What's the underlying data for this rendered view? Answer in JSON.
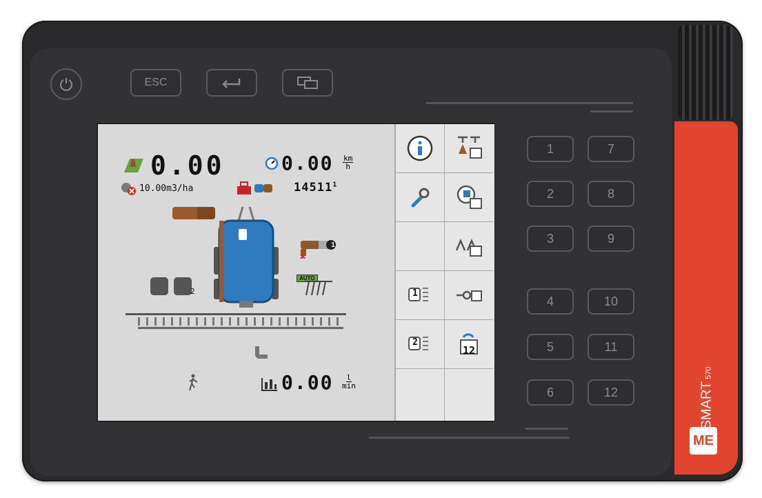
{
  "device": {
    "brand": "SMART",
    "model": "570",
    "logo_text": "ME",
    "keys": {
      "esc": "ESC",
      "power_icon": "power-icon",
      "enter_icon": "enter-icon",
      "switch_icon": "switch-screen-icon"
    },
    "function_keys_left": [
      "1",
      "2",
      "3",
      "4",
      "5",
      "6"
    ],
    "function_keys_right": [
      "7",
      "8",
      "9",
      "10",
      "11",
      "12"
    ]
  },
  "screen": {
    "application_rate": "0.00",
    "rate_target": "10.00m3/ha",
    "speed": "0.00",
    "speed_unit_top": "km",
    "speed_unit_bottom": "h",
    "counter": "14511",
    "counter_sup": "1",
    "auto_label": "AUTO",
    "nozzle_index": "1",
    "section_index": "2",
    "flow": "0.00",
    "flow_unit_top": "l",
    "flow_unit_bottom": "min",
    "softkeys_left": [
      "info-icon",
      "wrench-icon",
      "",
      "section-1-icon",
      "section-2-icon",
      ""
    ],
    "softkeys_right": [
      "boom-height-icon",
      "tank-fill-icon",
      "boom-fold-icon",
      "valve-icon",
      "counter-12-icon",
      ""
    ],
    "sk_label_1": "1",
    "sk_label_2": "2",
    "sk_label_12": "12"
  },
  "colors": {
    "accent": "#e2452f",
    "tank": "#2f7bc0",
    "screen_bg": "#d9d9d9"
  }
}
